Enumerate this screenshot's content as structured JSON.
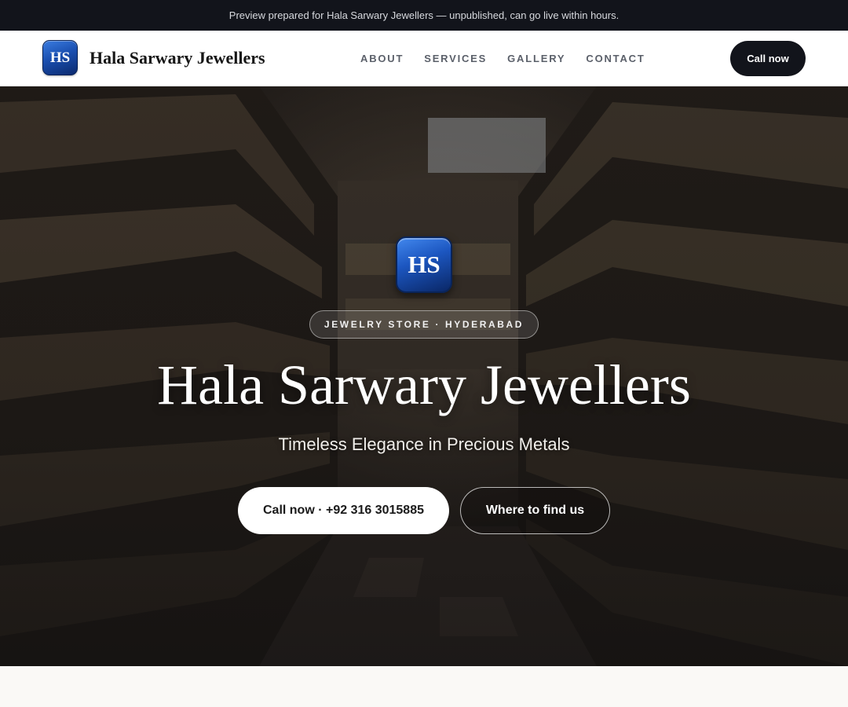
{
  "banner": {
    "text": "Preview prepared for Hala Sarwary Jewellers — unpublished, can go live within hours."
  },
  "header": {
    "logo_text": "HS",
    "brand_name": "Hala Sarwary Jewellers",
    "nav": [
      {
        "label": "ABOUT"
      },
      {
        "label": "SERVICES"
      },
      {
        "label": "GALLERY"
      },
      {
        "label": "CONTACT"
      }
    ],
    "call_label": "Call now"
  },
  "hero": {
    "background_image": "store aisle with shelves of packaged goods",
    "logo_text": "HS",
    "badge": "JEWELRY STORE · HYDERABAD",
    "title": "Hala Sarwary Jewellers",
    "subtitle": "Timeless Elegance in Precious Metals",
    "primary_cta": "Call now · +92 316 3015885",
    "secondary_cta": "Where to find us"
  },
  "colors": {
    "banner_bg": "#12141b",
    "header_bg": "#ffffff",
    "call_button_bg": "#12141b",
    "logo_blue": "#1a4fb0",
    "page_bg": "#faf9f6"
  }
}
